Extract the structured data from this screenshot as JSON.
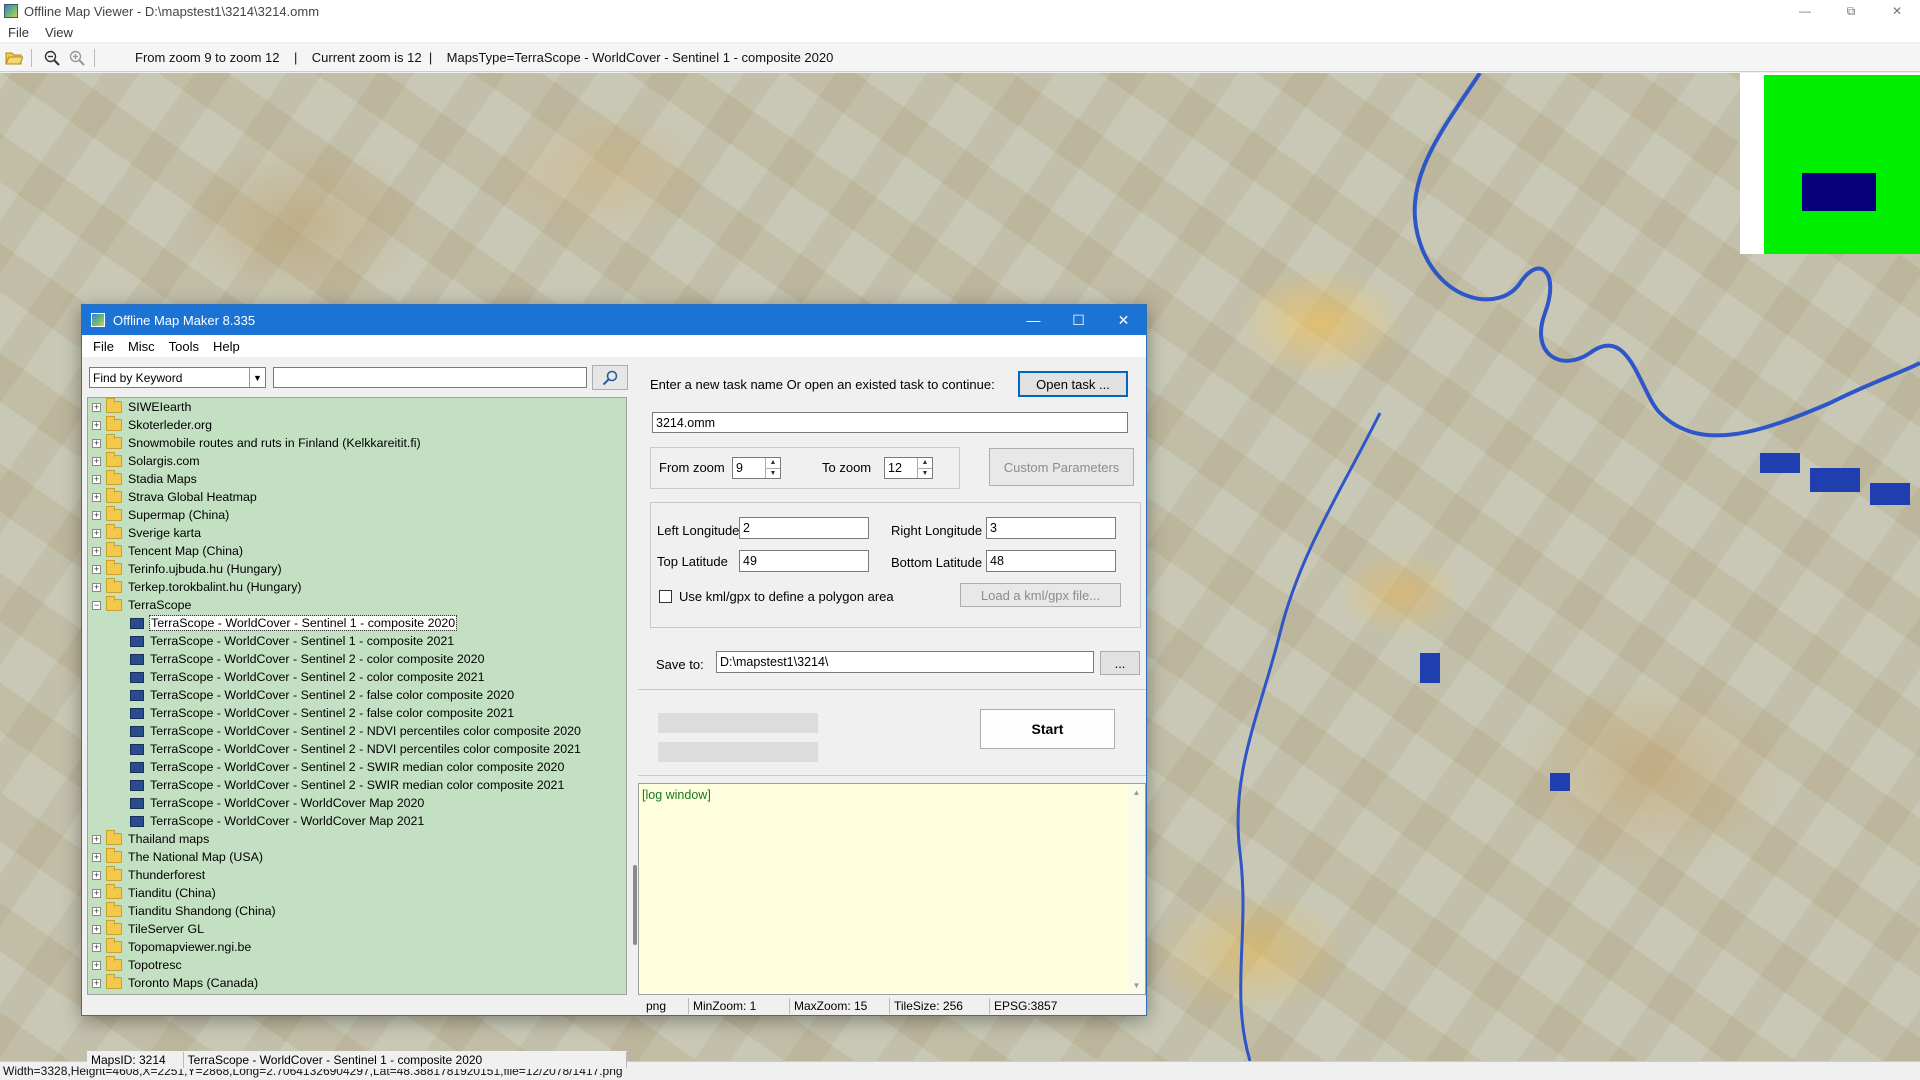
{
  "viewer": {
    "title": "Offline Map Viewer - D:\\mapstest1\\3214\\3214.omm",
    "menu": [
      "File",
      "View"
    ],
    "toolbar_info": "From zoom 9 to zoom 12    |    Current zoom is 12  |    MapsType=TerraScope - WorldCover - Sentinel 1 - composite 2020",
    "status": "Width=3328,Height=4608,X=2251,Y=2868,Long=2.70641326904297,Lat=48.3881781920151,file=12/2078/1417.png",
    "icons": [
      "folder-open-icon",
      "zoom-out-icon",
      "zoom-in-icon"
    ],
    "colors": {
      "minimap_bg": "#00ee00",
      "minimap_viewport": "#08007a"
    }
  },
  "dialog": {
    "title": "Offline Map Maker 8.335",
    "menu": [
      "File",
      "Misc",
      "Tools",
      "Help"
    ],
    "search": {
      "mode": "Find by Keyword",
      "value": ""
    },
    "tree": [
      {
        "label": "SIWEIearth",
        "type": "folder"
      },
      {
        "label": "Skoterleder.org",
        "type": "folder"
      },
      {
        "label": "Snowmobile routes and ruts in Finland (Kelkkareitit.fi)",
        "type": "folder"
      },
      {
        "label": "Solargis.com",
        "type": "folder"
      },
      {
        "label": "Stadia Maps",
        "type": "folder"
      },
      {
        "label": "Strava Global Heatmap",
        "type": "folder"
      },
      {
        "label": "Supermap (China)",
        "type": "folder"
      },
      {
        "label": "Sverige karta",
        "type": "folder"
      },
      {
        "label": "Tencent Map (China)",
        "type": "folder"
      },
      {
        "label": "Terinfo.ujbuda.hu (Hungary)",
        "type": "folder"
      },
      {
        "label": "Terkep.torokbalint.hu (Hungary)",
        "type": "folder"
      },
      {
        "label": "TerraScope",
        "type": "folder-open"
      },
      {
        "label": "TerraScope - WorldCover - Sentinel 1 - composite 2020",
        "type": "map",
        "selected": true
      },
      {
        "label": "TerraScope - WorldCover - Sentinel 1 - composite 2021",
        "type": "map"
      },
      {
        "label": "TerraScope - WorldCover - Sentinel 2 - color composite 2020",
        "type": "map"
      },
      {
        "label": "TerraScope - WorldCover - Sentinel 2 - color composite 2021",
        "type": "map"
      },
      {
        "label": "TerraScope - WorldCover - Sentinel 2 - false color composite 2020",
        "type": "map"
      },
      {
        "label": "TerraScope - WorldCover - Sentinel 2 - false color composite 2021",
        "type": "map"
      },
      {
        "label": "TerraScope - WorldCover - Sentinel 2 - NDVI percentiles color composite 2020",
        "type": "map"
      },
      {
        "label": "TerraScope - WorldCover - Sentinel 2 - NDVI percentiles color composite 2021",
        "type": "map"
      },
      {
        "label": "TerraScope - WorldCover - Sentinel 2 - SWIR median color composite 2020",
        "type": "map"
      },
      {
        "label": "TerraScope - WorldCover - Sentinel 2 - SWIR median color composite 2021",
        "type": "map"
      },
      {
        "label": "TerraScope - WorldCover - WorldCover Map 2020",
        "type": "map"
      },
      {
        "label": "TerraScope - WorldCover - WorldCover Map 2021",
        "type": "map"
      },
      {
        "label": "Thailand maps",
        "type": "folder"
      },
      {
        "label": "The National Map (USA)",
        "type": "folder"
      },
      {
        "label": "Thunderforest",
        "type": "folder"
      },
      {
        "label": "Tianditu (China)",
        "type": "folder"
      },
      {
        "label": "Tianditu Shandong (China)",
        "type": "folder"
      },
      {
        "label": "TileServer GL",
        "type": "folder"
      },
      {
        "label": "Topomapviewer.ngi.be",
        "type": "folder"
      },
      {
        "label": "Topotresc",
        "type": "folder"
      },
      {
        "label": "Toronto Maps (Canada)",
        "type": "folder"
      }
    ],
    "status": {
      "maps_id": "MapsID: 3214",
      "map_name": "TerraScope - WorldCover - Sentinel 1 - composite 2020",
      "format": "png",
      "min_zoom": "MinZoom: 1",
      "max_zoom": "MaxZoom: 15",
      "tile_size": "TileSize: 256",
      "epsg": "EPSG:3857"
    },
    "task": {
      "prompt": "Enter a new task name Or open an existed task to continue:",
      "open_button": "Open task ...",
      "name": "3214.omm"
    },
    "zoom": {
      "from_label": "From zoom",
      "from_value": "9",
      "to_label": "To zoom",
      "to_value": "12",
      "custom_button": "Custom Parameters"
    },
    "coords": {
      "left_lon_label": "Left Longitude",
      "left_lon": "2",
      "right_lon_label": "Right Longitude",
      "right_lon": "3",
      "top_lat_label": "Top Latitude",
      "top_lat": "49",
      "bottom_lat_label": "Bottom Latitude",
      "bottom_lat": "48",
      "kml_label": "Use kml/gpx to define a polygon area",
      "load_button": "Load a kml/gpx file..."
    },
    "save": {
      "label": "Save to:",
      "path": "D:\\mapstest1\\3214\\",
      "browse": "..."
    },
    "start_button": "Start",
    "log_text": "[log window]"
  }
}
